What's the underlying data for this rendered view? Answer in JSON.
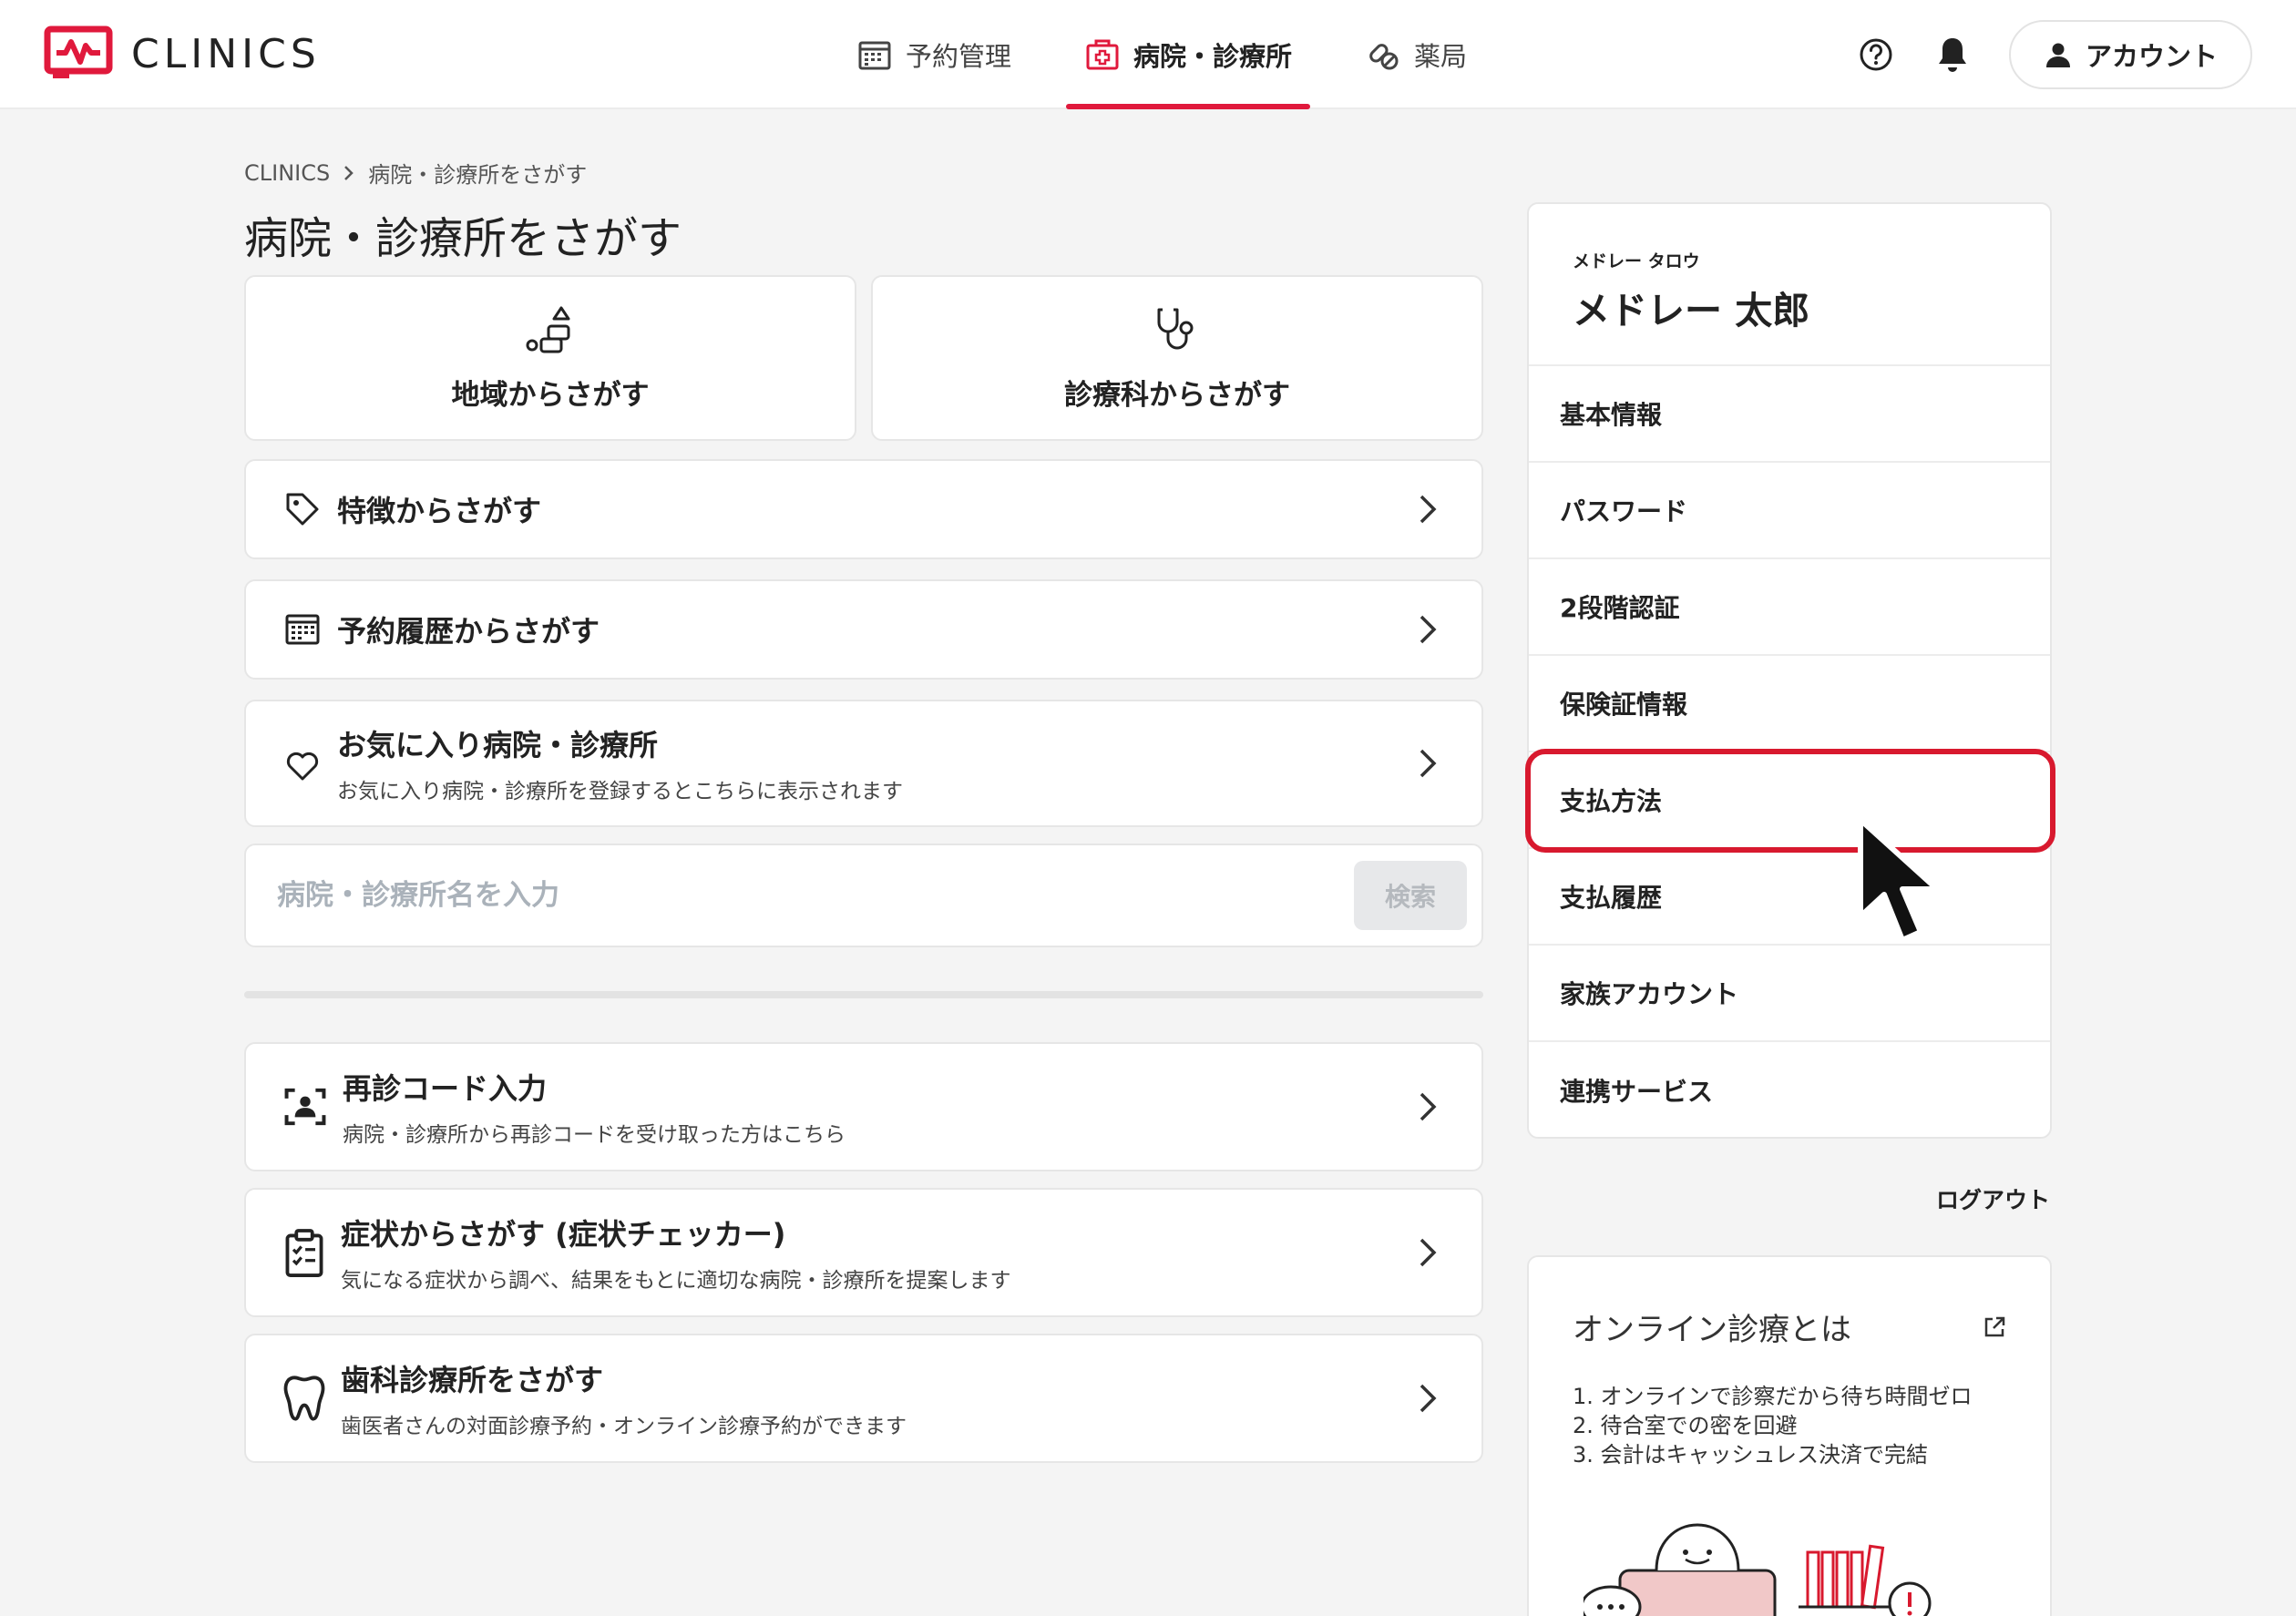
{
  "header": {
    "brand": "CLINICS",
    "nav": [
      {
        "label": "予約管理",
        "icon": "calendar-icon"
      },
      {
        "label": "病院・診療所",
        "icon": "hospital-icon",
        "active": true
      },
      {
        "label": "薬局",
        "icon": "pill-icon"
      }
    ],
    "account_label": "アカウント"
  },
  "breadcrumb": {
    "home": "CLINICS",
    "current": "病院・診療所をさがす"
  },
  "page_title": "病院・診療所をさがす",
  "top_cards": [
    {
      "label": "地域からさがす",
      "icon": "region-icon"
    },
    {
      "label": "診療科からさがす",
      "icon": "stethoscope-icon"
    }
  ],
  "rows": [
    {
      "title": "特徴からさがす",
      "icon": "tag-icon"
    },
    {
      "title": "予約履歴からさがす",
      "icon": "calendar-icon"
    },
    {
      "title": "お気に入り病院・診療所",
      "sub": "お気に入り病院・診療所を登録するとこちらに表示されます",
      "icon": "heart-icon"
    }
  ],
  "search": {
    "placeholder": "病院・診療所名を入力",
    "button": "検索"
  },
  "rows2": [
    {
      "title": "再診コード入力",
      "sub": "病院・診療所から再診コードを受け取った方はこちら",
      "icon": "scan-person-icon"
    },
    {
      "title": "症状からさがす (症状チェッカー)",
      "sub": "気になる症状から調べ、結果をもとに適切な病院・診療所を提案します",
      "icon": "clipboard-check-icon"
    },
    {
      "title": "歯科診療所をさがす",
      "sub": "歯医者さんの対面診療予約・オンライン診療予約ができます",
      "icon": "tooth-icon"
    }
  ],
  "sidebar": {
    "kana": "メドレー タロウ",
    "name": "メドレー 太郎",
    "items": [
      "基本情報",
      "パスワード",
      "2段階認証",
      "保険証情報",
      "支払方法",
      "支払履歴",
      "家族アカウント",
      "連携サービス"
    ],
    "highlighted": "支払方法",
    "logout": "ログアウト"
  },
  "info": {
    "title": "オンライン診療とは",
    "points": [
      "1. オンラインで診察だから待ち時間ゼロ",
      "2. 待合室での密を回避",
      "3. 会計はキャッシュレス決済で完結"
    ]
  },
  "colors": {
    "accent": "#e0193c",
    "highlight": "#d8192e"
  }
}
